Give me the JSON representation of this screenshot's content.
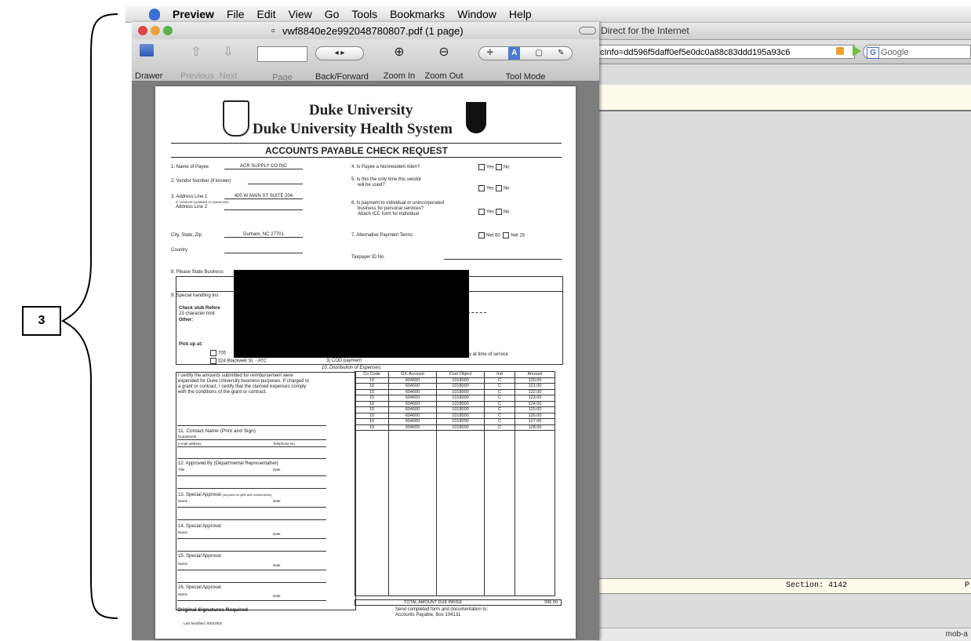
{
  "annotation": {
    "label": "3"
  },
  "menubar": {
    "items": [
      "Preview",
      "File",
      "Edit",
      "View",
      "Go",
      "Tools",
      "Bookmarks",
      "Window",
      "Help"
    ]
  },
  "preview": {
    "title": "vwf8840e2e992048780807.pdf (1 page)",
    "toolbar": {
      "drawer": "Drawer",
      "previous": "Previous",
      "next": "Next",
      "page": "Page",
      "back_forward": "Back/Forward",
      "zoom_in": "Zoom In",
      "zoom_out": "Zoom Out",
      "tool_mode": "Tool Mode"
    }
  },
  "browser": {
    "title": "Direct for the Internet",
    "url": "cInfo=dd596f5daff0ef5e0dc0a88c83ddd195a93c6",
    "search_placeholder": "Google",
    "status_section": "Section: 4142",
    "status_right": "P",
    "bottom": "mob-a"
  },
  "document": {
    "org1": "Duke University",
    "org2": "Duke University Health System",
    "form_title": "ACCOUNTS PAYABLE CHECK REQUEST",
    "f1_label": "1.  Name of Payee",
    "f1_value": "ACR SUPPLY CO INC",
    "f2_label": "2.  Vendor Number (if known)",
    "f3_label": "3.  Address Line 1",
    "f3_value": "400 W MAIN ST SUITE 204",
    "f3_note": "IF VENDOR NUMBER IS UNKNOWN",
    "f3b_label": "Address Line 2",
    "city_label": "City, State, Zip",
    "city_value": "Durham, NC 27701",
    "country_label": "Country",
    "q4": "4.  Is Payee a Nonresident Alien?",
    "q5a": "5.  Is this the only time this vendor",
    "q5b": "will be used?",
    "q6a": "6.  Is payment to individual or unincorporated",
    "q6b": "business for personal services?",
    "q6c": "Attach ICC form for individual",
    "q7": "7.  Alternative Payment Terms:",
    "net60": "Net 60",
    "net15": "Net 15",
    "yes": "Yes",
    "no": "No",
    "taxpayer": "Taxpayer ID No.",
    "f8": "8.  Please State Business",
    "f9": "9.  Special handling Ins",
    "check_stub": "Check stub Refere",
    "char_limit": "23 character limit",
    "other": "Other:",
    "pickup": "Pick up at:",
    "pickup1": "705",
    "pickup2": "324 Blackwell St. - ATC",
    "cod": "3) COD payment",
    "pay_time": "y at time of service",
    "dist": "10.  Distribution of Expenses:",
    "certify": "I certify the amounts submitted for reimbursement were expended for Duke University business purposes. If charged to a grant or contract, I certify that the claimed expenses comply with the conditions of the grant or contract.",
    "f11": "11.  Contact Name (Print and Sign)",
    "department": "Department",
    "email": "e-mail address",
    "telephone": "Telephone No.",
    "f12": "12.  Approved By (Departmental Representative)",
    "title": "Title",
    "date": "Date",
    "name": "Name",
    "f13": "13.  Special Approval",
    "f13_note": "(required for gifts and contributions)",
    "f14": "14.  Special Approval",
    "f15": "15.  Special Approval",
    "f16": "16.  Special Approval",
    "original_sig": "Original Signatures Required",
    "last_modified": "Last Modified: 9/20/2002",
    "send_to1": "Send completed form and documentation to:",
    "send_to2": "Accounts Payable, Box 104131",
    "total_label": "TOTAL AMOUNT DUE PAYEE",
    "total_value": "996.00",
    "table_headers": [
      "Co Code",
      "G/L Account",
      "Cost Object",
      "Ind",
      "Amount"
    ],
    "rows": [
      [
        "10",
        "604600",
        "1018000",
        "C",
        "120.00"
      ],
      [
        "10",
        "604600",
        "1018000",
        "C",
        "121.00"
      ],
      [
        "10",
        "604600",
        "1018000",
        "C",
        "122.00"
      ],
      [
        "10",
        "604600",
        "1018000",
        "C",
        "123.00"
      ],
      [
        "10",
        "604600",
        "1018000",
        "C",
        "124.00"
      ],
      [
        "10",
        "604600",
        "1018000",
        "C",
        "125.00"
      ],
      [
        "10",
        "604600",
        "1018000",
        "C",
        "126.00"
      ],
      [
        "10",
        "604600",
        "1018000",
        "C",
        "127.00"
      ],
      [
        "10",
        "604600",
        "1018000",
        "C",
        "128.00"
      ]
    ]
  }
}
